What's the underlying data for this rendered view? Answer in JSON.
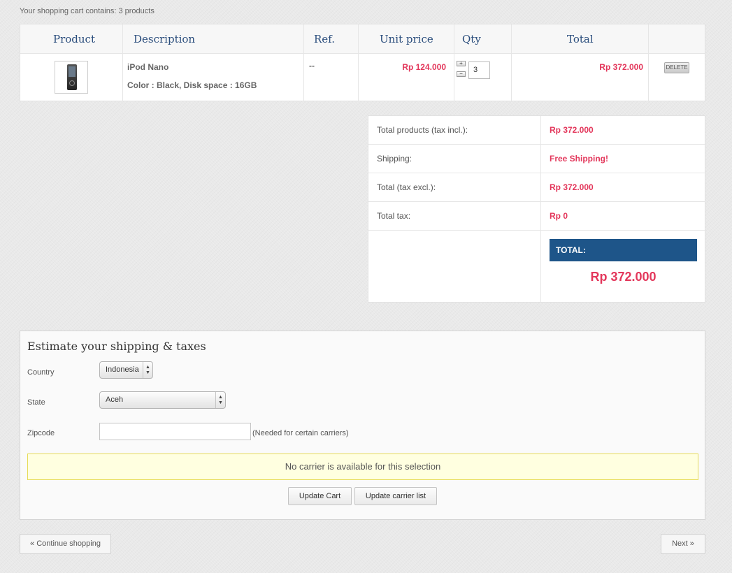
{
  "summary": {
    "text": "Your shopping cart contains: 3 products"
  },
  "cart": {
    "headers": {
      "product": "Product",
      "description": "Description",
      "ref": "Ref.",
      "unit_price": "Unit price",
      "qty": "Qty",
      "total": "Total"
    },
    "items": [
      {
        "name": "iPod Nano",
        "attributes": "Color : Black, Disk space : 16GB",
        "ref": "--",
        "unit_price": "Rp 124.000",
        "qty": "3",
        "qty_plus": "+",
        "qty_minus": "−",
        "total": "Rp 372.000",
        "delete_label": "DELETE",
        "thumbnail_icon": "ipod-nano-thumbnail"
      }
    ]
  },
  "totals": {
    "rows": [
      {
        "label": "Total products (tax incl.):",
        "value": "Rp 372.000"
      },
      {
        "label": "Shipping:",
        "value": "Free Shipping!"
      },
      {
        "label": "Total (tax excl.):",
        "value": "Rp 372.000"
      },
      {
        "label": "Total tax:",
        "value": "Rp 0"
      }
    ],
    "grand_label": "TOTAL:",
    "grand_value": "Rp 372.000"
  },
  "estimate": {
    "title": "Estimate your shipping & taxes",
    "country_label": "Country",
    "country_value": "Indonesia",
    "state_label": "State",
    "state_value": "Aceh",
    "zip_label": "Zipcode",
    "zip_value": "",
    "zip_hint": "(Needed for certain carriers)",
    "notice": "No carrier is available for this selection",
    "update_cart": "Update Cart",
    "update_carrier": "Update carrier list"
  },
  "nav": {
    "continue": "« Continue shopping",
    "next": "Next »"
  },
  "colors": {
    "price": "#e3375b",
    "header_text": "#2a4d7c",
    "total_bar": "#1e5589",
    "notice_bg": "#ffffe0"
  }
}
